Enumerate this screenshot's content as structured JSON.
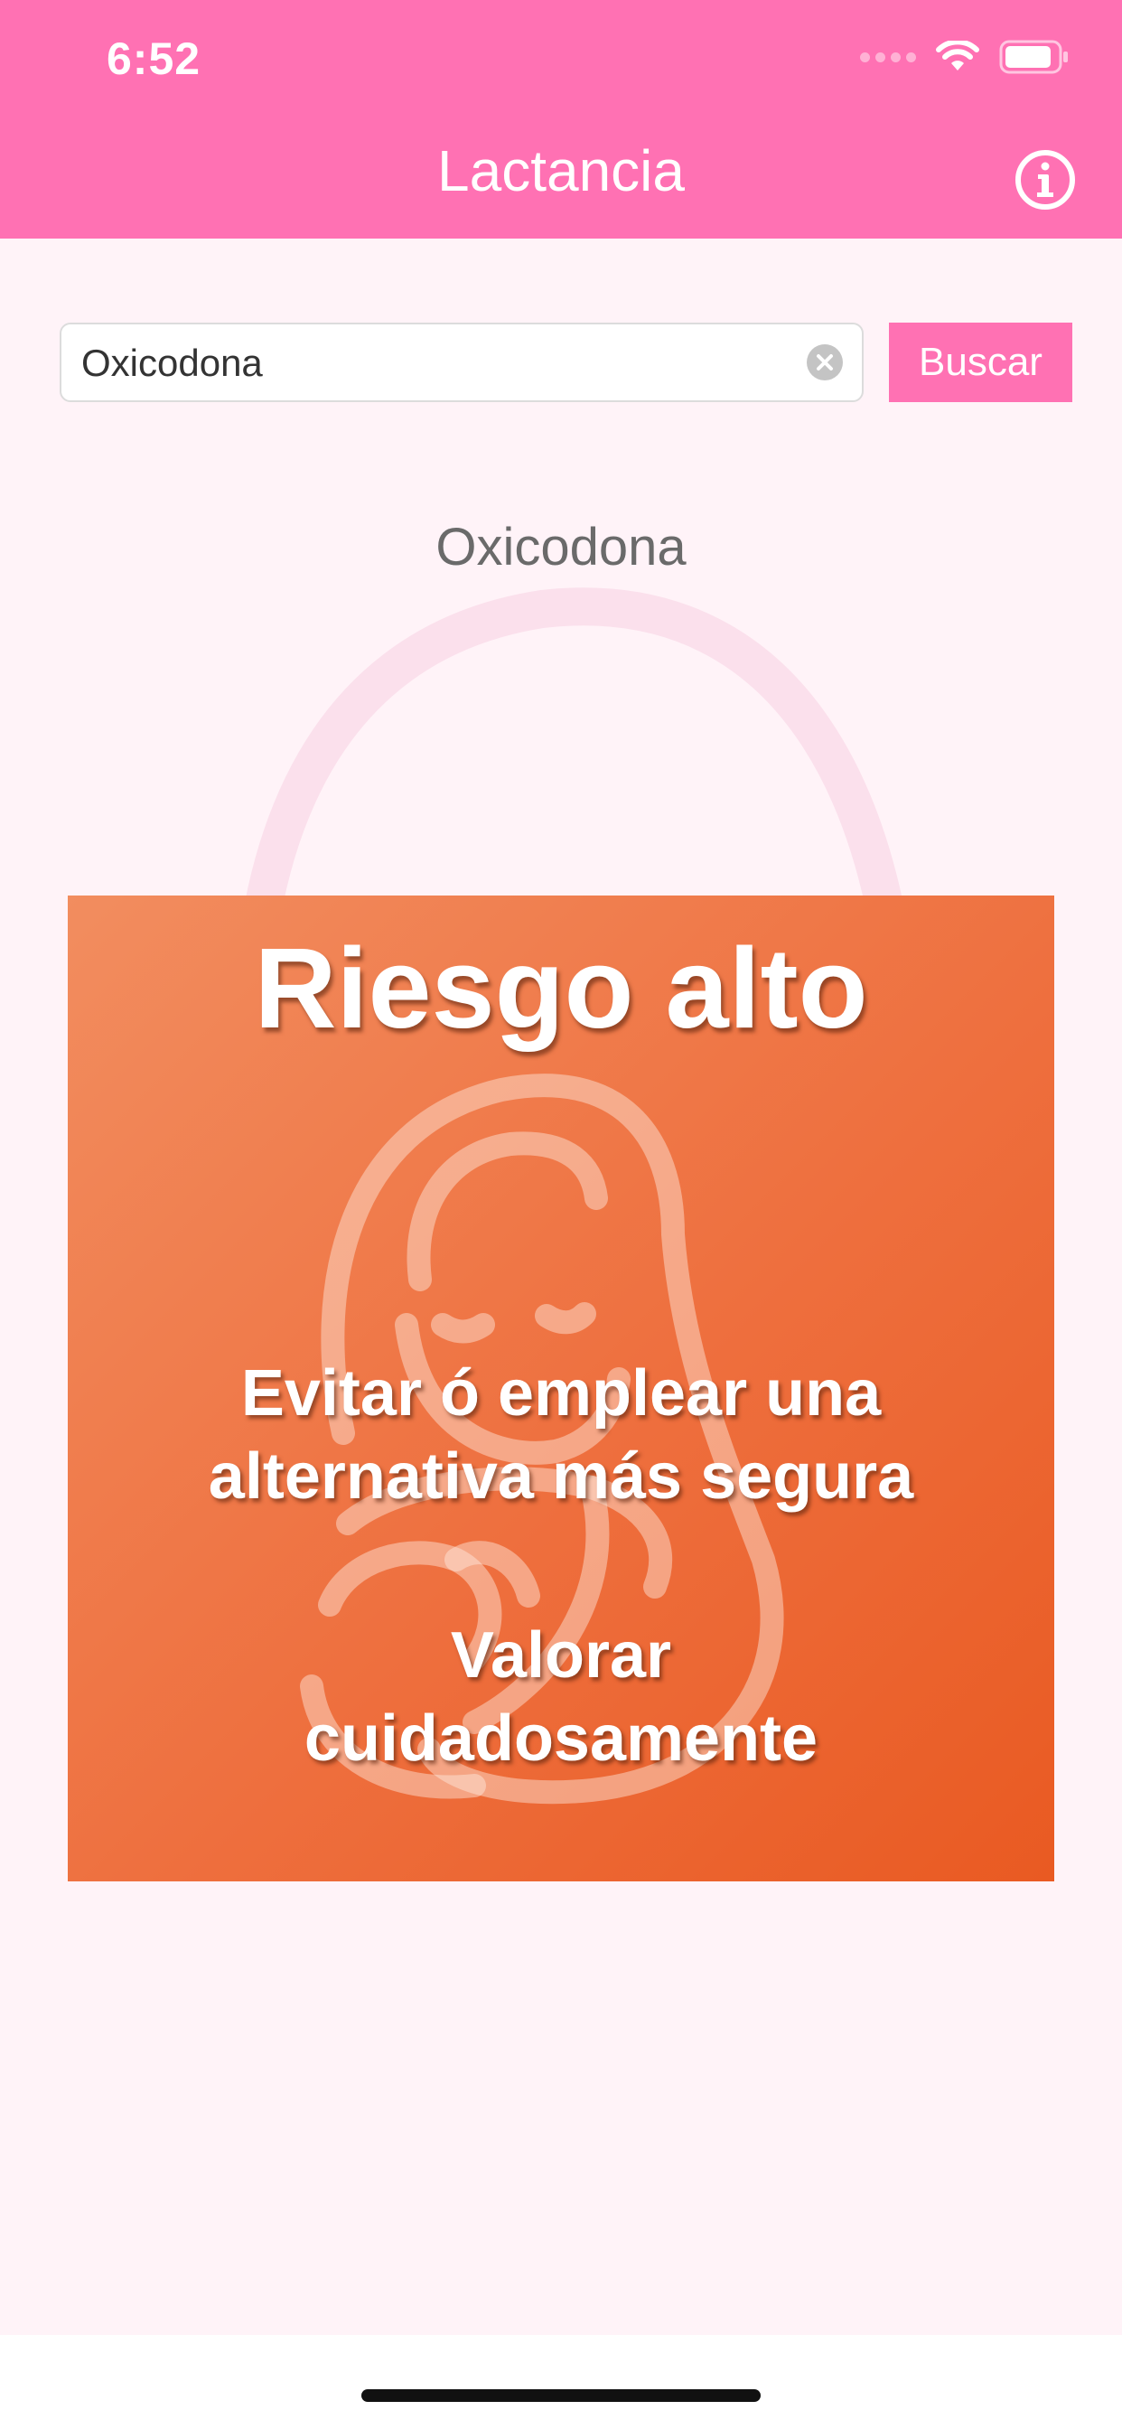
{
  "status_bar": {
    "time": "6:52"
  },
  "nav": {
    "title": "Lactancia"
  },
  "search": {
    "value": "Oxicodona",
    "button_label": "Buscar"
  },
  "result": {
    "drug_name": "Oxicodona",
    "risk_level": "Riesgo alto",
    "advice": "Evitar ó emplear una alternativa más segura",
    "note": "Valorar cuidadosamente"
  },
  "colors": {
    "brand_pink": "#ff71b3",
    "risk_orange": "#ee6f3e",
    "background": "#fff3f8"
  },
  "icons": {
    "info": "info-circle-icon",
    "clear": "clear-circle-icon",
    "wifi": "wifi-icon",
    "battery": "battery-icon",
    "signal": "cellular-signal-icon"
  }
}
